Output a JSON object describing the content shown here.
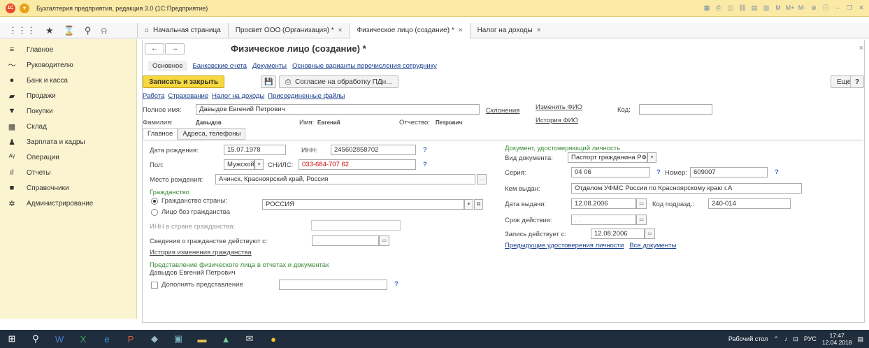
{
  "window": {
    "title": "Бухгалтерия предприятия, редакция 3.0 (1С:Предприятие)",
    "logo": "1С"
  },
  "tabs": [
    {
      "label": "Начальная страница",
      "icon": "home-icon"
    },
    {
      "label": "Просвет ООО (Организация) *",
      "close": "×"
    },
    {
      "label": "Физическое лицо (создание) *",
      "close": "×"
    },
    {
      "label": "Налог на доходы",
      "close": "×"
    }
  ],
  "sidebar": {
    "items": [
      {
        "label": "Главное",
        "icon": "≡"
      },
      {
        "label": "Руководителю",
        "icon": "〜"
      },
      {
        "label": "Банк и касса",
        "icon": "●"
      },
      {
        "label": "Продажи",
        "icon": "▰"
      },
      {
        "label": "Покупки",
        "icon": "▼"
      },
      {
        "label": "Склад",
        "icon": "▦"
      },
      {
        "label": "Зарплата и кадры",
        "icon": "♟"
      },
      {
        "label": "Операции",
        "icon": "ᴬᵞ"
      },
      {
        "label": "Отчеты",
        "icon": "ıl"
      },
      {
        "label": "Справочники",
        "icon": "■"
      },
      {
        "label": "Администрирование",
        "icon": "✲"
      }
    ]
  },
  "form": {
    "title": "Физическое лицо (создание) *",
    "subnav": [
      "Основное",
      "Банковские счета",
      "Документы",
      "Основные варианты перечисления сотруднику"
    ],
    "save_close": "Записать и закрыть",
    "consent": "Согласие на обработку ПДн...",
    "more": "Еще",
    "help": "?",
    "links": [
      "Работа",
      "Страхование",
      "Налог на доходы",
      "Присоединенные файлы"
    ],
    "full_name_label": "Полное имя:",
    "full_name": "Давыдов Евгений Петрович",
    "declensions": "Склонения",
    "change_fio": "Изменить ФИО",
    "code_label": "Код:",
    "fio_history": "История ФИО",
    "surname_label": "Фамилия:",
    "surname": "Давыдов",
    "name_label": "Имя:",
    "name": "Евгений",
    "patronymic_label": "Отчество:",
    "patronymic": "Петрович",
    "subtabs": [
      "Главное",
      "Адреса, телефоны"
    ],
    "birth_date_label": "Дата рождения:",
    "birth_date": "15.07.1978",
    "inn_label": "ИНН:",
    "inn": "245602858702",
    "sex_label": "Пол:",
    "sex": "Мужской",
    "snils_label": "СНИЛС:",
    "snils": "033-684-707 62",
    "birthplace_label": "Место рождения:",
    "birthplace": "Ачинск, Красноярский край, Россия",
    "citizenship_header": "Гражданство",
    "citizen_of_label": "Гражданство страны:",
    "citizen_country": "РОССИЯ",
    "stateless_label": "Лицо без гражданства",
    "inn_citizenship_label": "ИНН в стране гражданства:",
    "citizenship_since_label": "Сведения о гражданстве действуют с:",
    "citizenship_since": ". .",
    "citizenship_history": "История изменения гражданства",
    "representation_header": "Представление физического лица в отчетах и документах",
    "representation": "Давыдов Евгений Петрович",
    "append_representation": "Дополнять представление",
    "doc_header": "Документ, удостоверяющий личность",
    "doc_type_label": "Вид документа:",
    "doc_type": "Паспорт гражданина РФ",
    "series_label": "Серия:",
    "series": "04 06",
    "number_label": "Номер:",
    "number": "609007",
    "issued_by_label": "Кем выдан:",
    "issued_by": "Отделом УФМС России  по Красноярскому краю г.А",
    "issue_date_label": "Дата выдачи:",
    "issue_date": "12.08.2006",
    "dept_code_label": "Код подразд.:",
    "dept_code": "240-014",
    "valid_until_label": "Срок действия:",
    "valid_until": ". .",
    "record_from_label": "Запись действует с:",
    "record_from": "12.08.2006",
    "prev_docs": "Предыдущие удостоверения личности",
    "all_docs": "Все документы"
  },
  "taskbar": {
    "desktop": "Рабочий стол",
    "lang": "РУС",
    "time": "17:47",
    "date": "12.04.2018"
  }
}
